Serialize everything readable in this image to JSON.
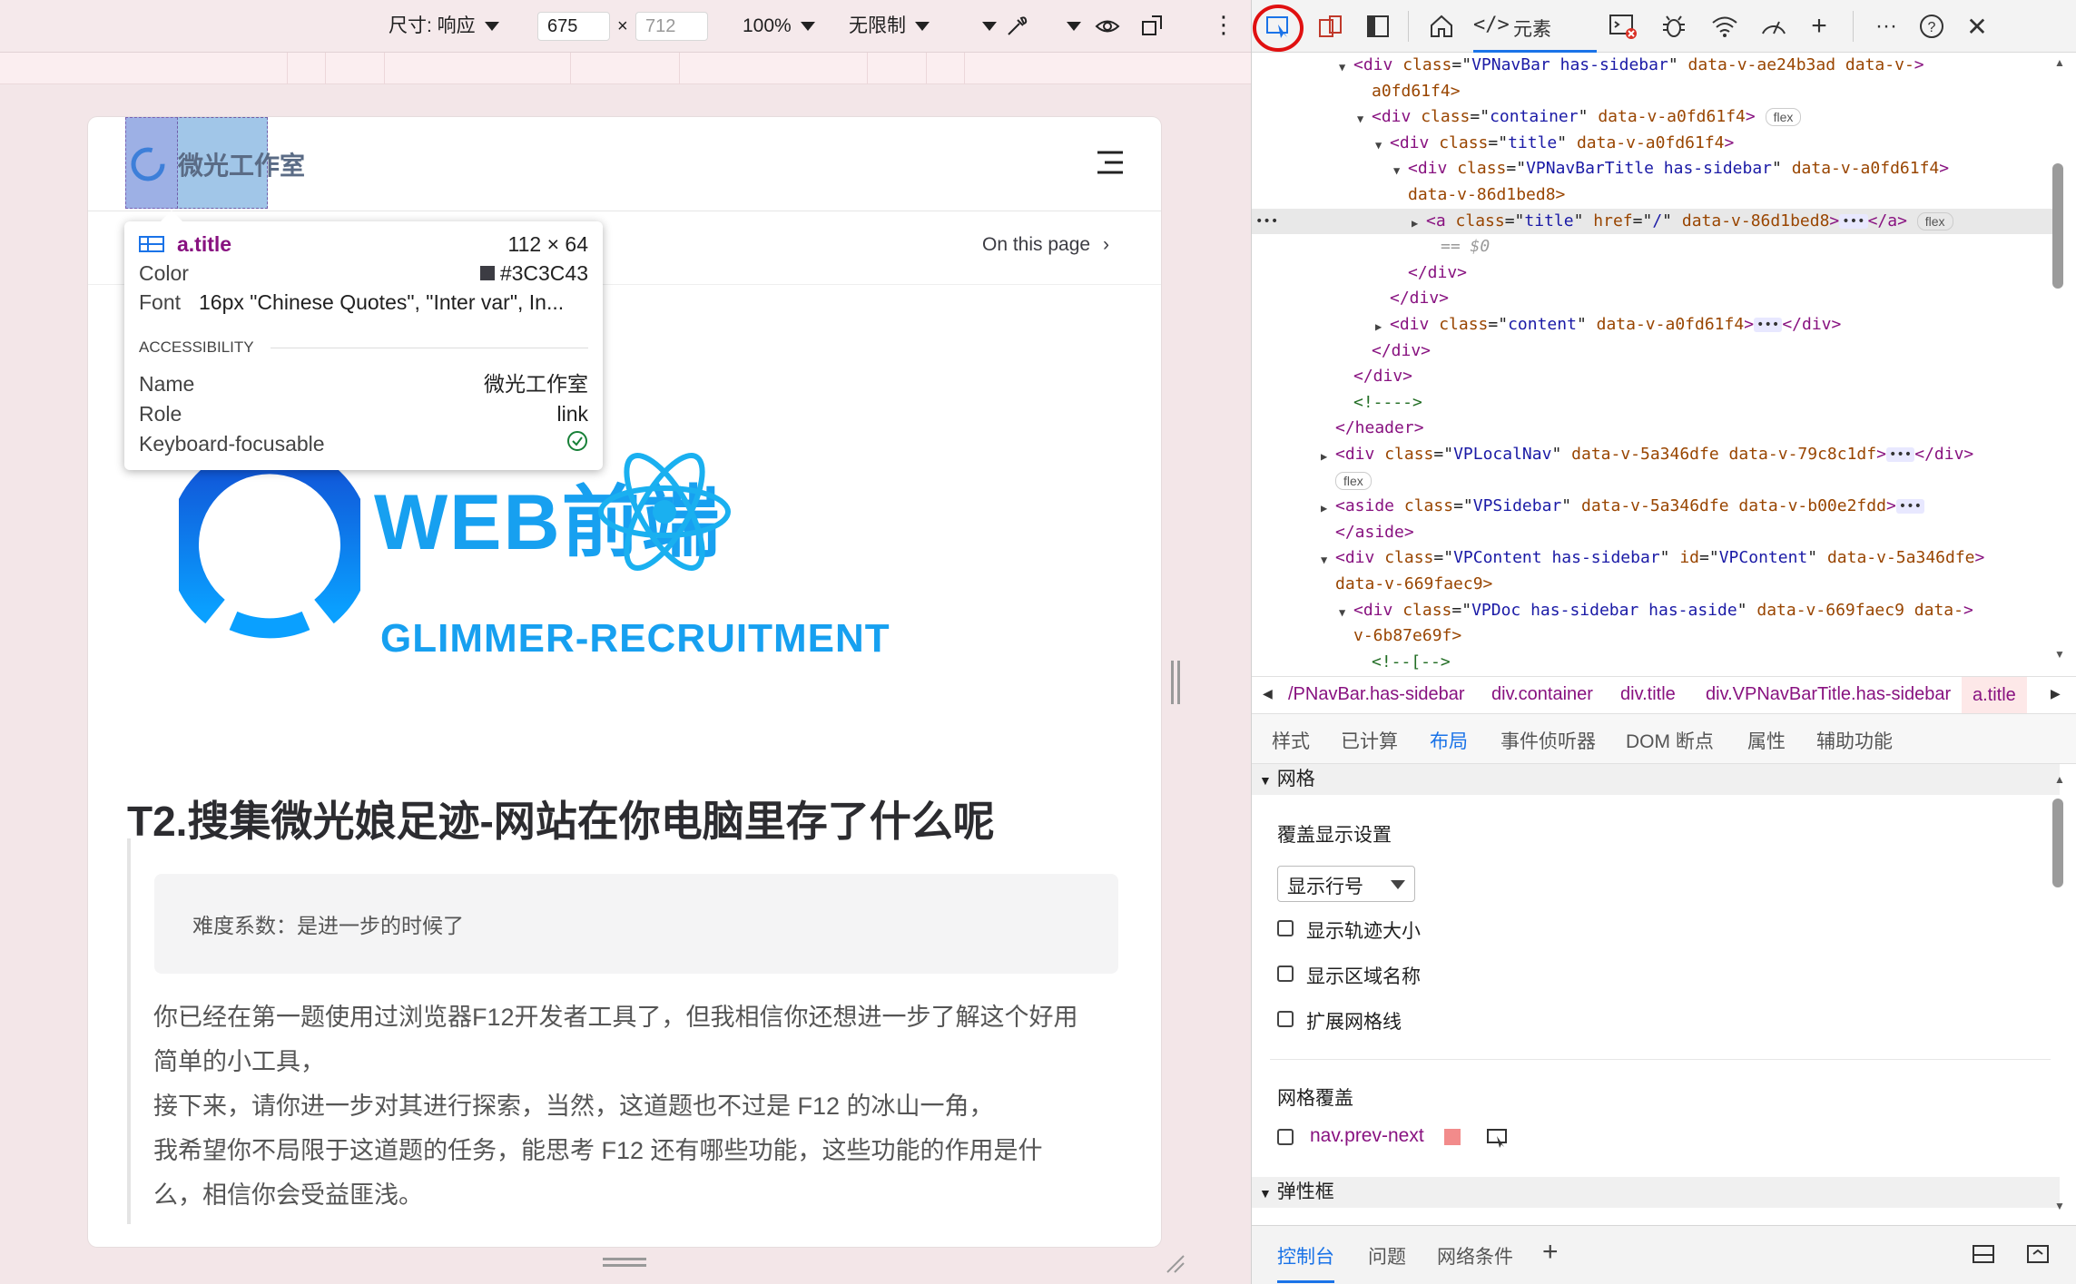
{
  "device_toolbar": {
    "size_label": "尺寸: 响应",
    "width": "675",
    "height": "712",
    "zoom": "100%",
    "throttle": "无限制"
  },
  "page": {
    "site_name": "微光工作室",
    "on_this_page": "On this page",
    "banner_title": "WEB前端",
    "banner_subtitle": "GLIMMER-RECRUITMENT",
    "heading": "T2.搜集微光娘足迹-网站在你电脑里存了什么呢",
    "difficulty": "难度系数：是进一步的时候了",
    "paragraph_lines": [
      "你已经在第一题使用过浏览器F12开发者工具了，但我相信你还想进一步了解这个好用",
      "简单的小工具，",
      "接下来，请你进一步对其进行探索，当然，这道题也不过是 F12 的冰山一角，",
      "我希望你不局限于这道题的任务，能思考 F12 还有哪些功能，这些功能的作用是什",
      "么，相信你会受益匪浅。"
    ]
  },
  "tooltip": {
    "selector": "a.title",
    "size": "112 × 64",
    "color_label": "Color",
    "color_value": "#3C3C43",
    "font_label": "Font",
    "font_value": "16px \"Chinese Quotes\", \"Inter var\", In...",
    "accessibility_header": "ACCESSIBILITY",
    "name_label": "Name",
    "name_value": "微光工作室",
    "role_label": "Role",
    "role_value": "link",
    "focus_label": "Keyboard-focusable"
  },
  "devtools": {
    "elements_tab": "元素",
    "tree": [
      {
        "indent": 0,
        "arrow": "open",
        "tag": "div",
        "attrs": [
          [
            "class",
            "VPNavBar has-sidebar"
          ],
          [
            "data-v-ae24b3ad",
            ""
          ],
          [
            "data-v-",
            ""
          ]
        ],
        "text_tail": ""
      },
      {
        "indent": 1,
        "arrow": "none",
        "raw": "a0fd61f4>"
      },
      {
        "indent": 1,
        "arrow": "open",
        "tag": "div",
        "attrs": [
          [
            "class",
            "container"
          ],
          [
            "data-v-a0fd61f4",
            ""
          ]
        ],
        "badge": "flex"
      },
      {
        "indent": 2,
        "arrow": "open",
        "tag": "div",
        "attrs": [
          [
            "class",
            "title"
          ],
          [
            "data-v-a0fd61f4",
            ""
          ]
        ]
      },
      {
        "indent": 3,
        "arrow": "open",
        "tag": "div",
        "attrs": [
          [
            "class",
            "VPNavBarTitle has-sidebar"
          ],
          [
            "data-v-a0fd61f4",
            ""
          ]
        ]
      },
      {
        "indent": 3,
        "arrow": "none",
        "raw": "data-v-86d1bed8>"
      },
      {
        "indent": 4,
        "arrow": "closed",
        "tag": "a",
        "attrs": [
          [
            "class",
            "title"
          ],
          [
            "href",
            "/"
          ],
          [
            "data-v-86d1bed8",
            ""
          ]
        ],
        "ellipsis": true,
        "close": "</a>",
        "badge": "flex",
        "selected": true
      },
      {
        "indent": 4,
        "arrow": "none",
        "raw": "== $0",
        "dim": true
      },
      {
        "indent": 3,
        "arrow": "none",
        "raw": "</div>"
      },
      {
        "indent": 2,
        "arrow": "none",
        "raw": "</div>"
      },
      {
        "indent": 2,
        "arrow": "closed",
        "tag": "div",
        "attrs": [
          [
            "class",
            "content"
          ],
          [
            "data-v-a0fd61f4",
            ""
          ]
        ],
        "ellipsis": true,
        "close": "</div>"
      },
      {
        "indent": 1,
        "arrow": "none",
        "raw": "</div>"
      },
      {
        "indent": 0,
        "arrow": "none",
        "raw": "</div>"
      },
      {
        "indent": 0,
        "arrow": "none",
        "raw": "<!---->"
      },
      {
        "indent": -1,
        "arrow": "none",
        "raw": "</header>"
      },
      {
        "indent": -1,
        "arrow": "closed",
        "tag": "div",
        "attrs": [
          [
            "class",
            "VPLocalNav"
          ],
          [
            "data-v-5a346dfe",
            ""
          ],
          [
            "data-v-79c8c1df",
            ""
          ]
        ],
        "ellipsis": true,
        "close": "</div>"
      },
      {
        "indent": -1,
        "arrow": "none",
        "badge_only": "flex"
      },
      {
        "indent": -1,
        "arrow": "closed",
        "tag": "aside",
        "attrs": [
          [
            "class",
            "VPSidebar"
          ],
          [
            "data-v-5a346dfe",
            ""
          ],
          [
            "data-v-b00e2fdd",
            ""
          ]
        ],
        "ellipsis": true
      },
      {
        "indent": -1,
        "arrow": "none",
        "raw": "</aside>"
      },
      {
        "indent": -1,
        "arrow": "open",
        "tag": "div",
        "attrs": [
          [
            "class",
            "VPContent has-sidebar"
          ],
          [
            "id",
            "VPContent"
          ],
          [
            "data-v-5a346dfe",
            ""
          ]
        ]
      },
      {
        "indent": -1,
        "arrow": "none",
        "raw": "data-v-669faec9>"
      },
      {
        "indent": 0,
        "arrow": "open",
        "tag": "div",
        "attrs": [
          [
            "class",
            "VPDoc has-sidebar has-aside"
          ],
          [
            "data-v-669faec9",
            ""
          ],
          [
            "data-",
            ""
          ]
        ]
      },
      {
        "indent": 0,
        "arrow": "none",
        "raw": "v-6b87e69f>"
      },
      {
        "indent": 1,
        "arrow": "none",
        "raw": "<!--[-->"
      }
    ],
    "breadcrumbs": [
      "/PNavBar.has-sidebar",
      "div.container",
      "div.title",
      "div.VPNavBarTitle.has-sidebar",
      "a.title"
    ],
    "subtabs": [
      "样式",
      "已计算",
      "布局",
      "事件侦听器",
      "DOM 断点",
      "属性",
      "辅助功能"
    ],
    "layout": {
      "grid_header": "网格",
      "overlay_settings": "覆盖显示设置",
      "select_value": "显示行号",
      "options": [
        "显示轨迹大小",
        "显示区域名称",
        "扩展网格线"
      ],
      "grid_overlay": "网格覆盖",
      "overlay_item": "nav.prev-next",
      "overlay_color": "#f28b8b",
      "flexbox_header": "弹性框"
    },
    "drawer_tabs": [
      "控制台",
      "问题",
      "网络条件"
    ]
  },
  "colors": {
    "accent": "#1a73e8",
    "brand_blue": "#1677ff",
    "red_circle": "#e01010"
  }
}
